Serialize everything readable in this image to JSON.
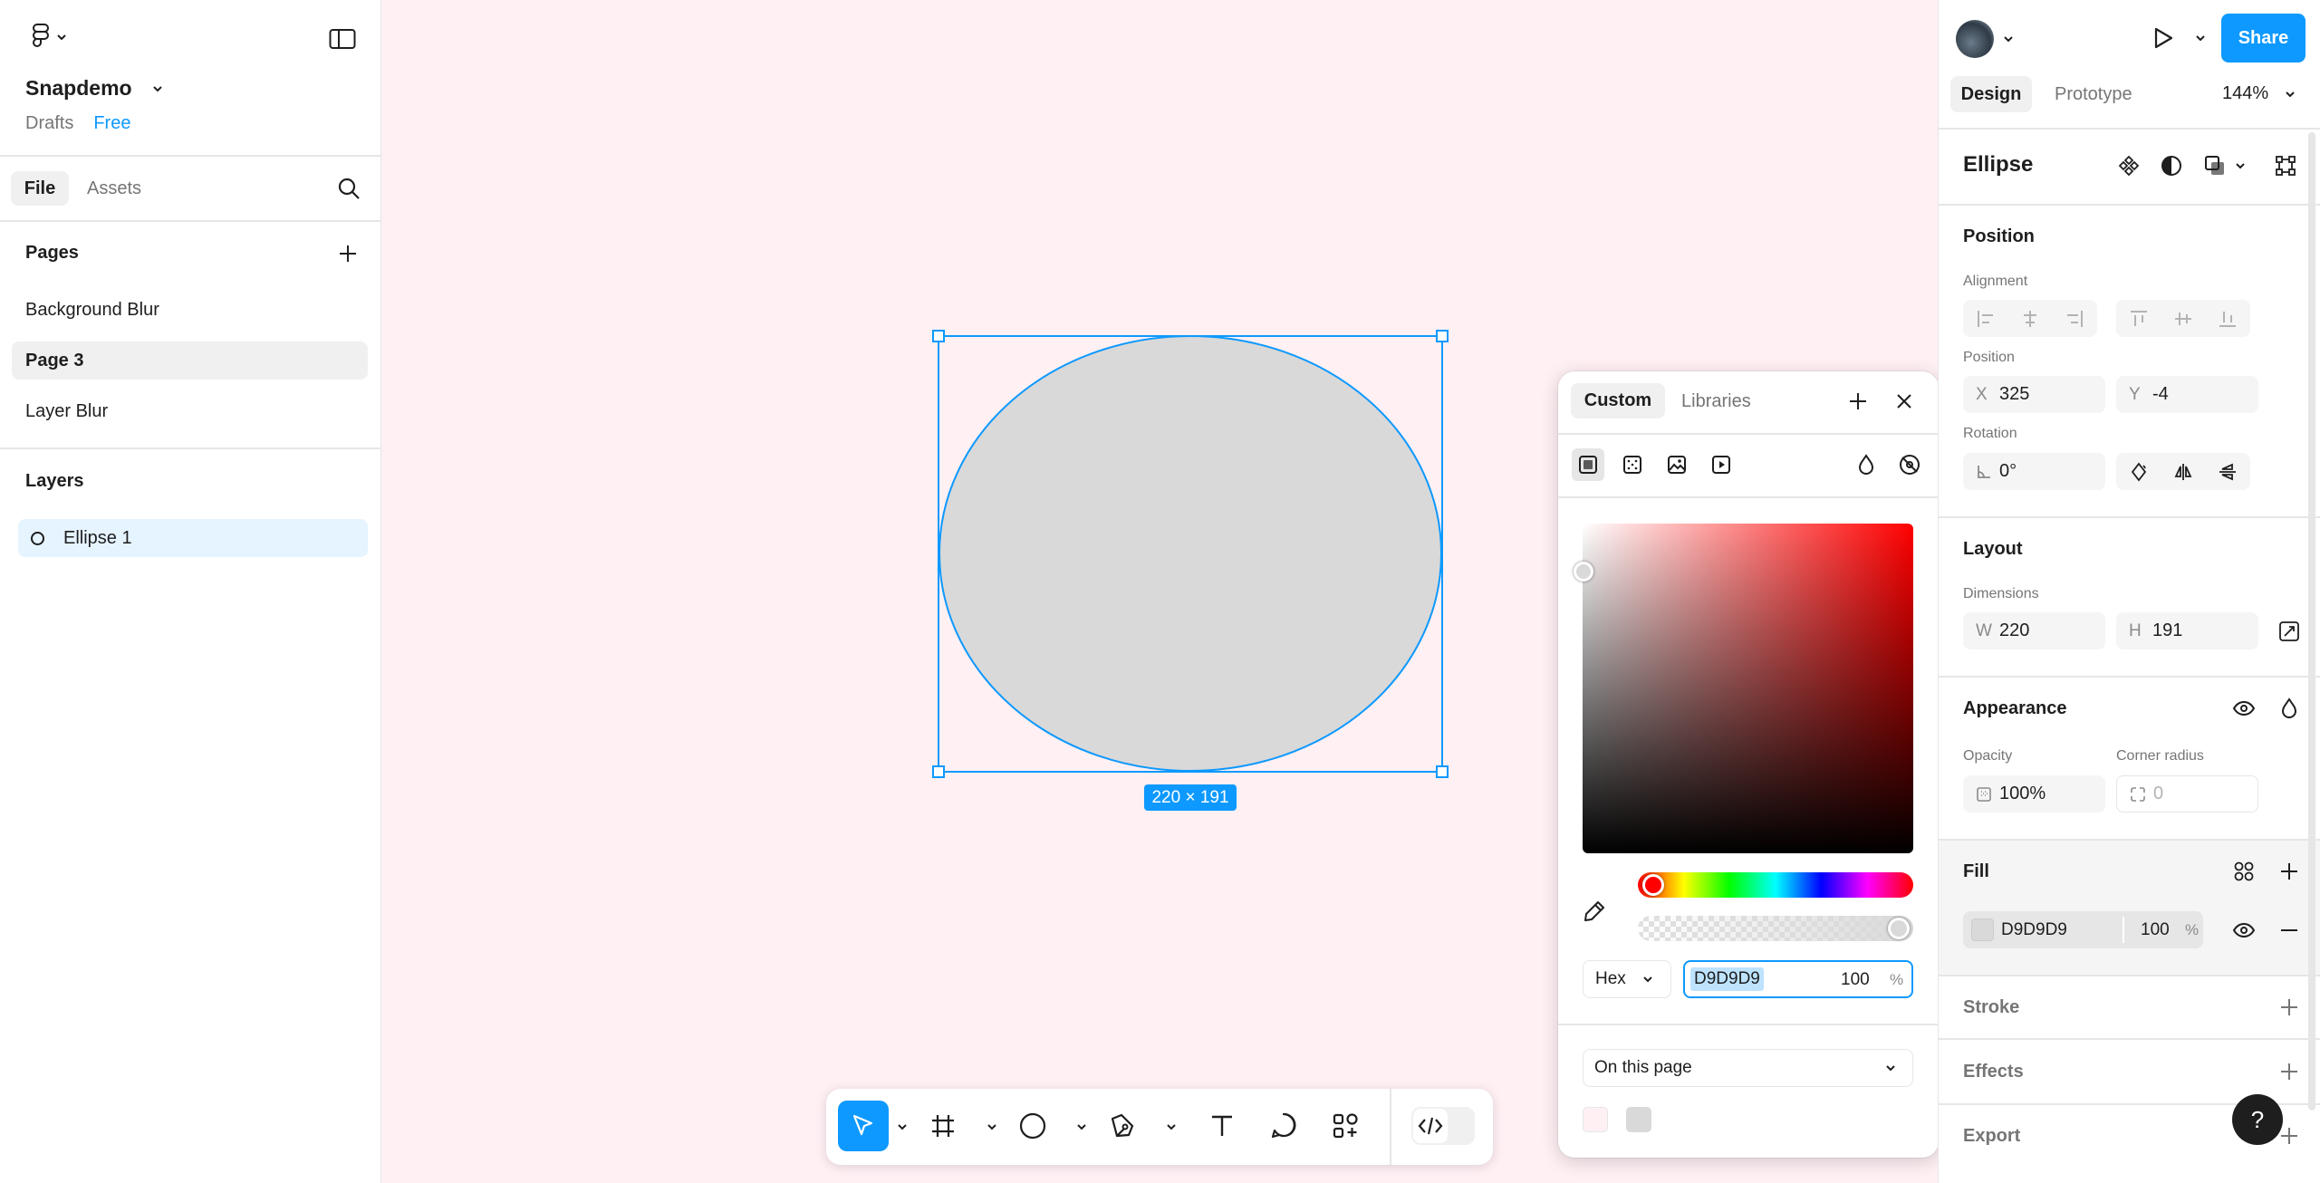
{
  "app": {
    "file_name": "Snapdemo",
    "drafts_label": "Drafts",
    "plan_badge": "Free"
  },
  "left_tabs": {
    "file": "File",
    "assets": "Assets"
  },
  "pages": {
    "title": "Pages",
    "items": [
      "Background Blur",
      "Page 3",
      "Layer Blur"
    ],
    "selected_index": 1
  },
  "layers": {
    "title": "Layers",
    "items": [
      {
        "name": "Ellipse 1",
        "type": "ellipse"
      }
    ]
  },
  "canvas": {
    "background": "#fff0f4",
    "size_label": "220 × 191",
    "selection_color": "#0d99ff",
    "shape_fill": "#D9D9D9"
  },
  "right": {
    "tabs": {
      "design": "Design",
      "prototype": "Prototype"
    },
    "zoom": "144%",
    "share_label": "Share",
    "selection_title": "Ellipse",
    "position": {
      "title": "Position",
      "alignment_label": "Alignment",
      "position_label": "Position",
      "x_prefix": "X",
      "x": "325",
      "y_prefix": "Y",
      "y": "-4",
      "rotation_label": "Rotation",
      "rotation": "0°"
    },
    "layout": {
      "title": "Layout",
      "dimensions_label": "Dimensions",
      "w_prefix": "W",
      "w": "220",
      "h_prefix": "H",
      "h": "191"
    },
    "appearance": {
      "title": "Appearance",
      "opacity_label": "Opacity",
      "opacity": "100%",
      "corner_label": "Corner radius",
      "corner_placeholder": "0"
    },
    "fill": {
      "title": "Fill",
      "hex": "D9D9D9",
      "opacity": "100",
      "unit": "%"
    },
    "stroke_title": "Stroke",
    "effects_title": "Effects",
    "export_title": "Export"
  },
  "picker": {
    "tabs": {
      "custom": "Custom",
      "libraries": "Libraries"
    },
    "format": "Hex",
    "hex": "D9D9D9",
    "opacity": "100",
    "unit": "%",
    "swatch_scope": "On this page",
    "swatches": [
      "#fff0f4",
      "#d9d9d9"
    ]
  },
  "colors": {
    "accent": "#0d99ff",
    "selected_page_bg": "#f0f0f0",
    "selected_layer_bg": "#e5f4ff"
  }
}
